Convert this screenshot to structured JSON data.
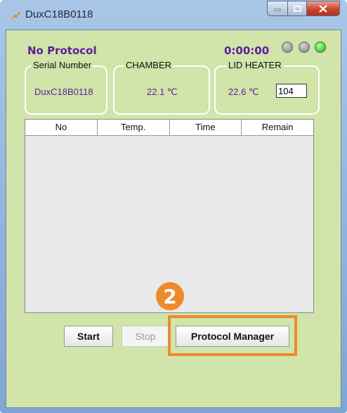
{
  "window": {
    "title": "DuxC18B0118"
  },
  "header": {
    "protocol_label": "No Protocol",
    "timer": "0:00:00",
    "indicators": [
      {
        "state": "off",
        "color": "#8a8a8a"
      },
      {
        "state": "off",
        "color": "#8a8a8a"
      },
      {
        "state": "on",
        "color": "#22b022"
      }
    ]
  },
  "serial": {
    "label": "Serial Number",
    "value": "DuxC18B0118"
  },
  "chamber": {
    "label": "CHAMBER",
    "value": "22.1 ℃"
  },
  "lid_heater": {
    "label": "LID HEATER",
    "value": "22.6 ℃",
    "setpoint": "104"
  },
  "table": {
    "columns": [
      "No",
      "Temp.",
      "Time",
      "Remain"
    ],
    "rows": []
  },
  "buttons": {
    "start": "Start",
    "stop": "Stop",
    "protocol_manager": "Protocol Manager"
  },
  "annotation": {
    "step_number": "2",
    "color": "#ee8a2c"
  }
}
